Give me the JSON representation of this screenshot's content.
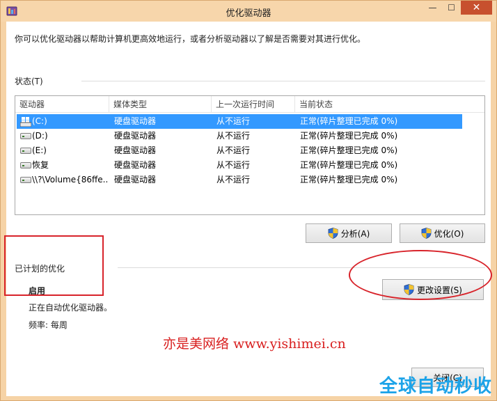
{
  "window": {
    "title": "优化驱动器",
    "minimize": "—",
    "maximize": "☐",
    "close": "✕"
  },
  "description": "你可以优化驱动器以帮助计算机更高效地运行，或者分析驱动器以了解是否需要对其进行优化。",
  "status": {
    "label": "状态(T)",
    "columns": [
      "驱动器",
      "媒体类型",
      "上一次运行时间",
      "当前状态"
    ],
    "rows": [
      {
        "drive": "(C:)",
        "media": "硬盘驱动器",
        "last_run": "从不运行",
        "state": "正常(碎片整理已完成 0%)",
        "icon": "system-drive-icon",
        "selected": true
      },
      {
        "drive": "(D:)",
        "media": "硬盘驱动器",
        "last_run": "从不运行",
        "state": "正常(碎片整理已完成 0%)",
        "icon": "drive-icon"
      },
      {
        "drive": "(E:)",
        "media": "硬盘驱动器",
        "last_run": "从不运行",
        "state": "正常(碎片整理已完成 0%)",
        "icon": "drive-icon"
      },
      {
        "drive": "恢复",
        "media": "硬盘驱动器",
        "last_run": "从不运行",
        "state": "正常(碎片整理已完成 0%)",
        "icon": "drive-icon"
      },
      {
        "drive": "\\\\?\\Volume{86ffe...",
        "media": "硬盘驱动器",
        "last_run": "从不运行",
        "state": "正常(碎片整理已完成 0%)",
        "icon": "drive-icon"
      }
    ]
  },
  "buttons": {
    "analyze": "分析(A)",
    "optimize": "优化(O)",
    "change_settings": "更改设置(S)",
    "close": "关闭(C)"
  },
  "scheduled": {
    "label": "已计划的优化",
    "enabled": "启用",
    "running": "正在自动优化驱动器。",
    "frequency": "频率: 每周"
  },
  "watermarks": {
    "site": "亦是美网络 www.yishimei.cn",
    "corner": "全球自动秒收"
  },
  "colors": {
    "selection": "#3399ff",
    "highlight": "#d8232a",
    "watermark": "#d81e1e"
  }
}
